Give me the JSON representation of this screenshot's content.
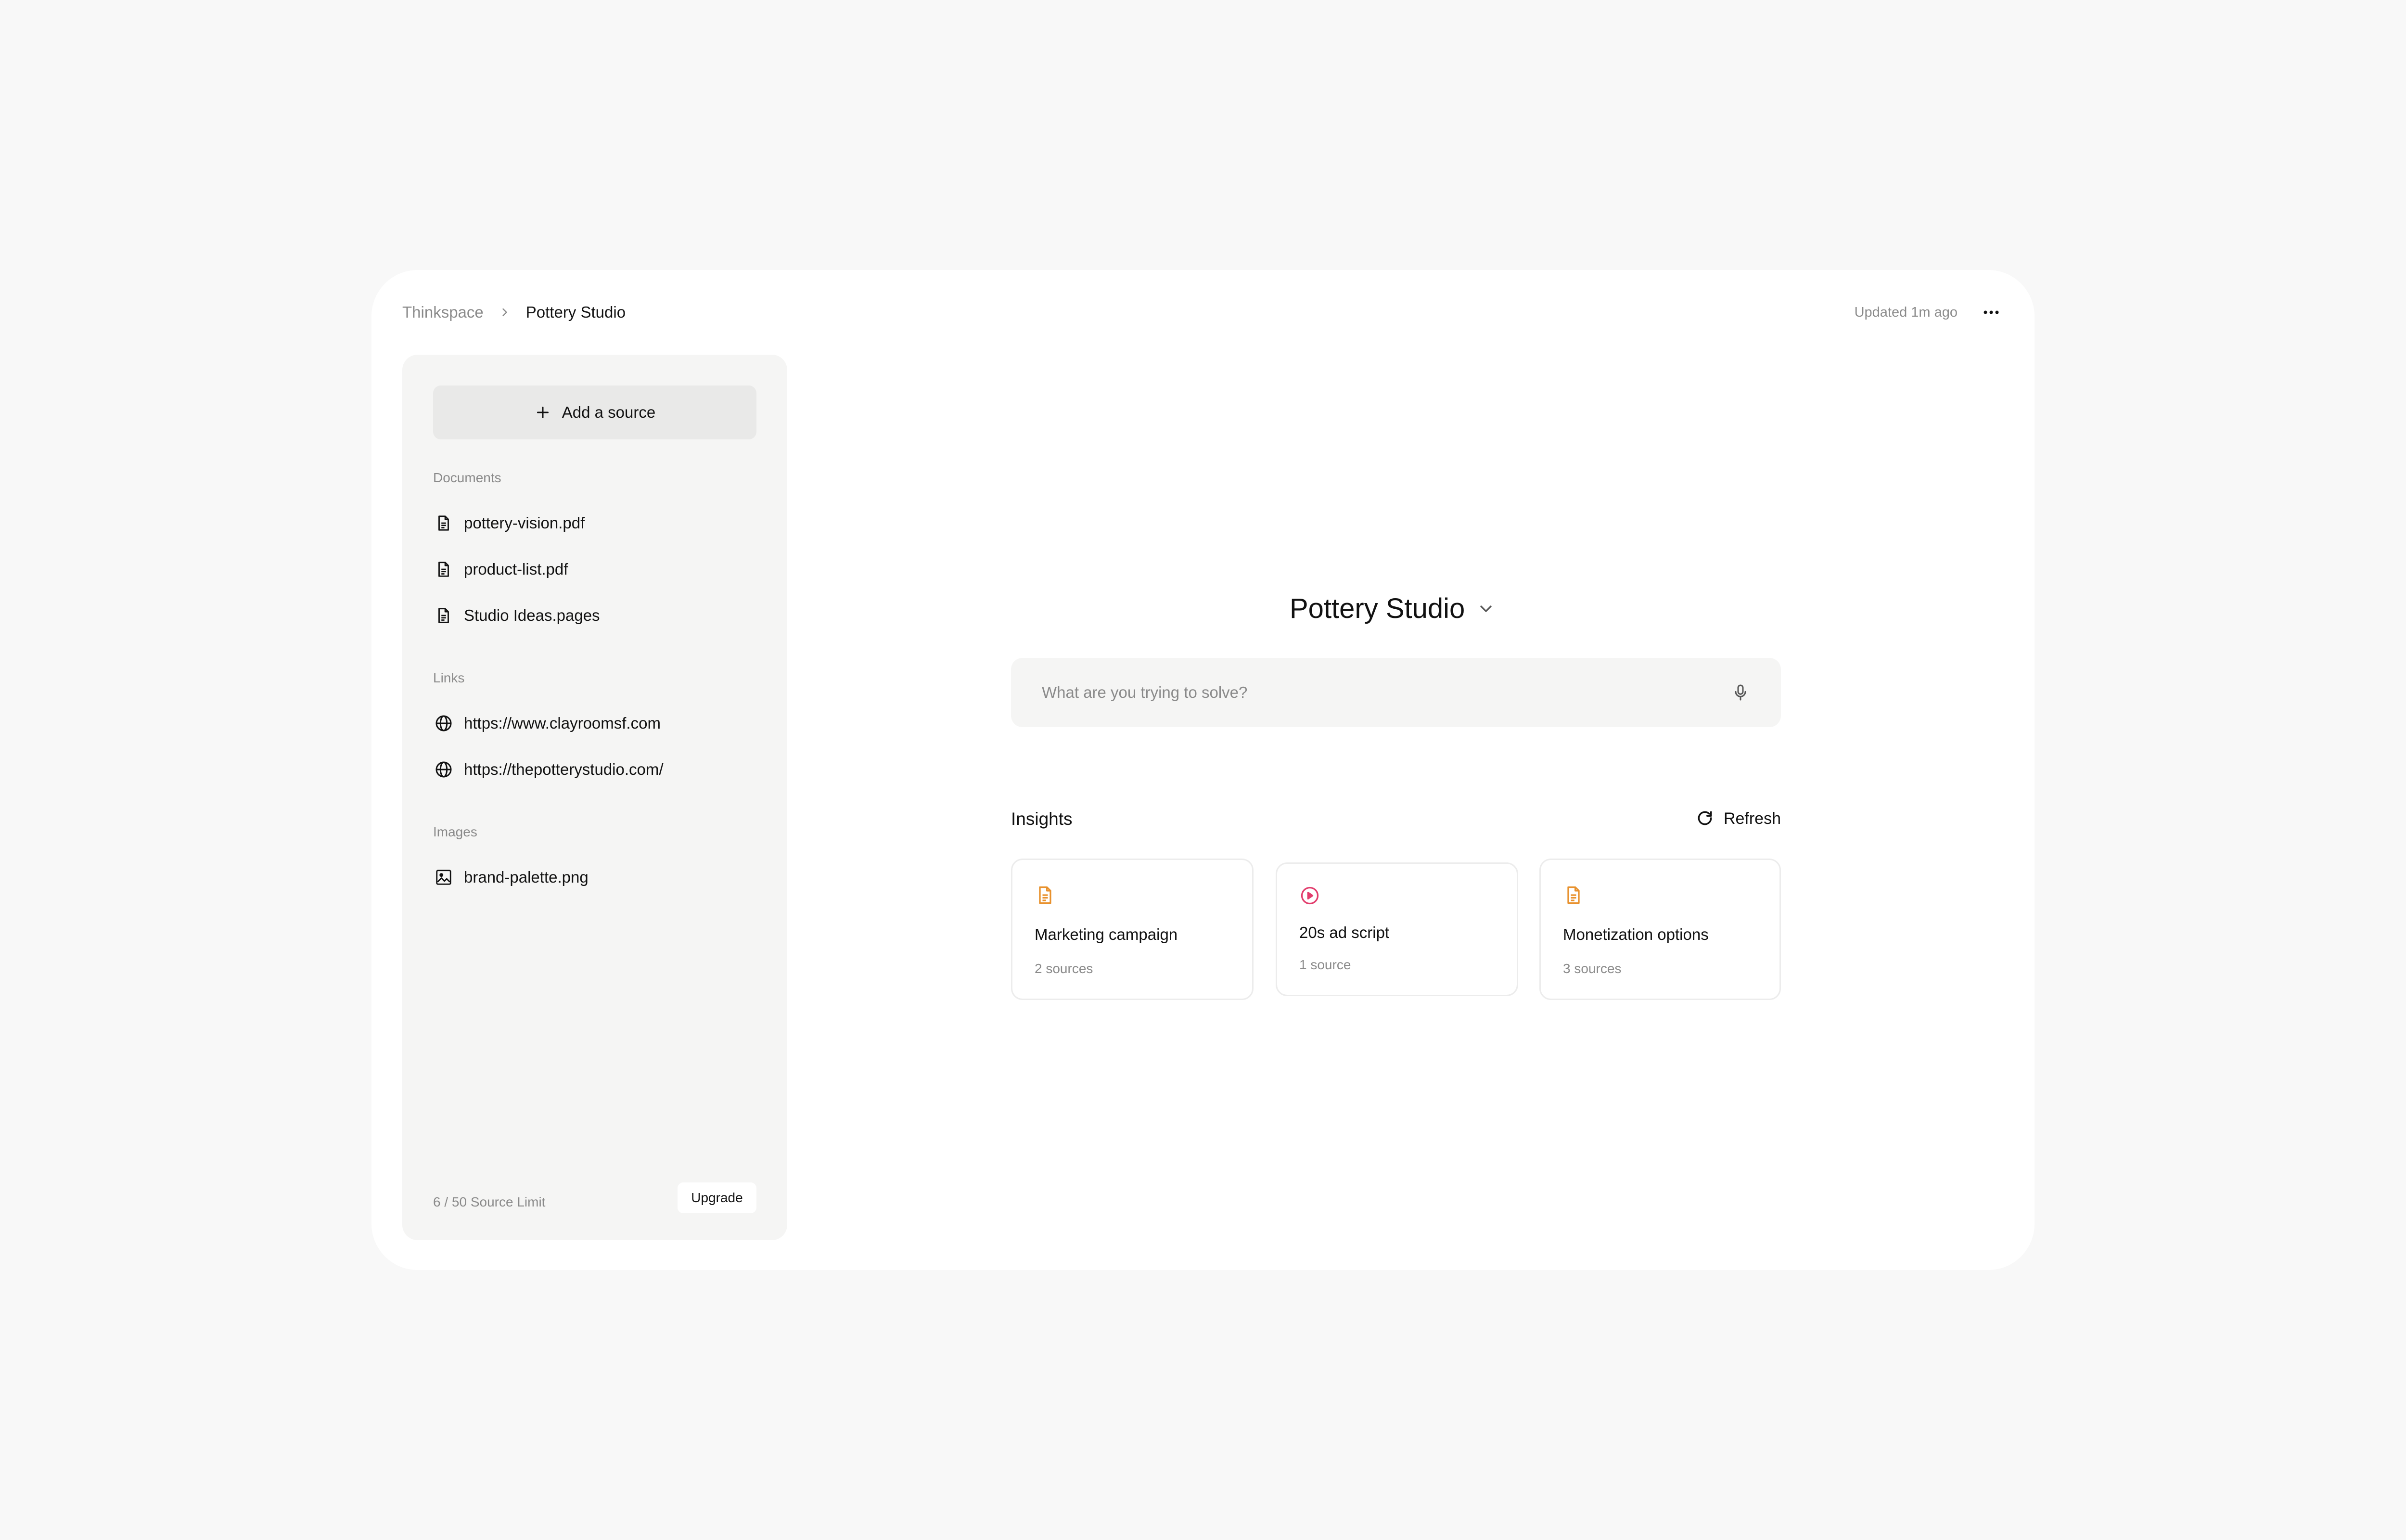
{
  "breadcrumb": {
    "root": "Thinkspace",
    "current": "Pottery Studio"
  },
  "header": {
    "updated": "Updated 1m ago",
    "more_icon": "ellipsis-icon"
  },
  "sidebar": {
    "add_source_label": "Add a source",
    "documents_label": "Documents",
    "documents": [
      {
        "name": "pottery-vision.pdf",
        "icon": "document-icon"
      },
      {
        "name": "product-list.pdf",
        "icon": "document-icon"
      },
      {
        "name": "Studio Ideas.pages",
        "icon": "document-icon"
      }
    ],
    "links_label": "Links",
    "links": [
      {
        "url": "https://www.clayroomsf.com",
        "icon": "globe-icon"
      },
      {
        "url": "https://thepotterystudio.com/",
        "icon": "globe-icon"
      }
    ],
    "images_label": "Images",
    "images": [
      {
        "name": "brand-palette.png",
        "icon": "image-icon"
      }
    ],
    "limit_text": "6 / 50 Source Limit",
    "upgrade_label": "Upgrade"
  },
  "main": {
    "project_title": "Pottery Studio",
    "search_placeholder": "What are you trying to solve?",
    "insights_title": "Insights",
    "refresh_label": "Refresh",
    "cards": [
      {
        "title": "Marketing campaign",
        "sources": "2 sources",
        "icon": "document-icon",
        "color": "#e8912d"
      },
      {
        "title": "20s ad script",
        "sources": "1 source",
        "icon": "play-circle-icon",
        "color": "#e23d6d"
      },
      {
        "title": "Monetization options",
        "sources": "3 sources",
        "icon": "document-icon",
        "color": "#e8912d"
      }
    ]
  }
}
